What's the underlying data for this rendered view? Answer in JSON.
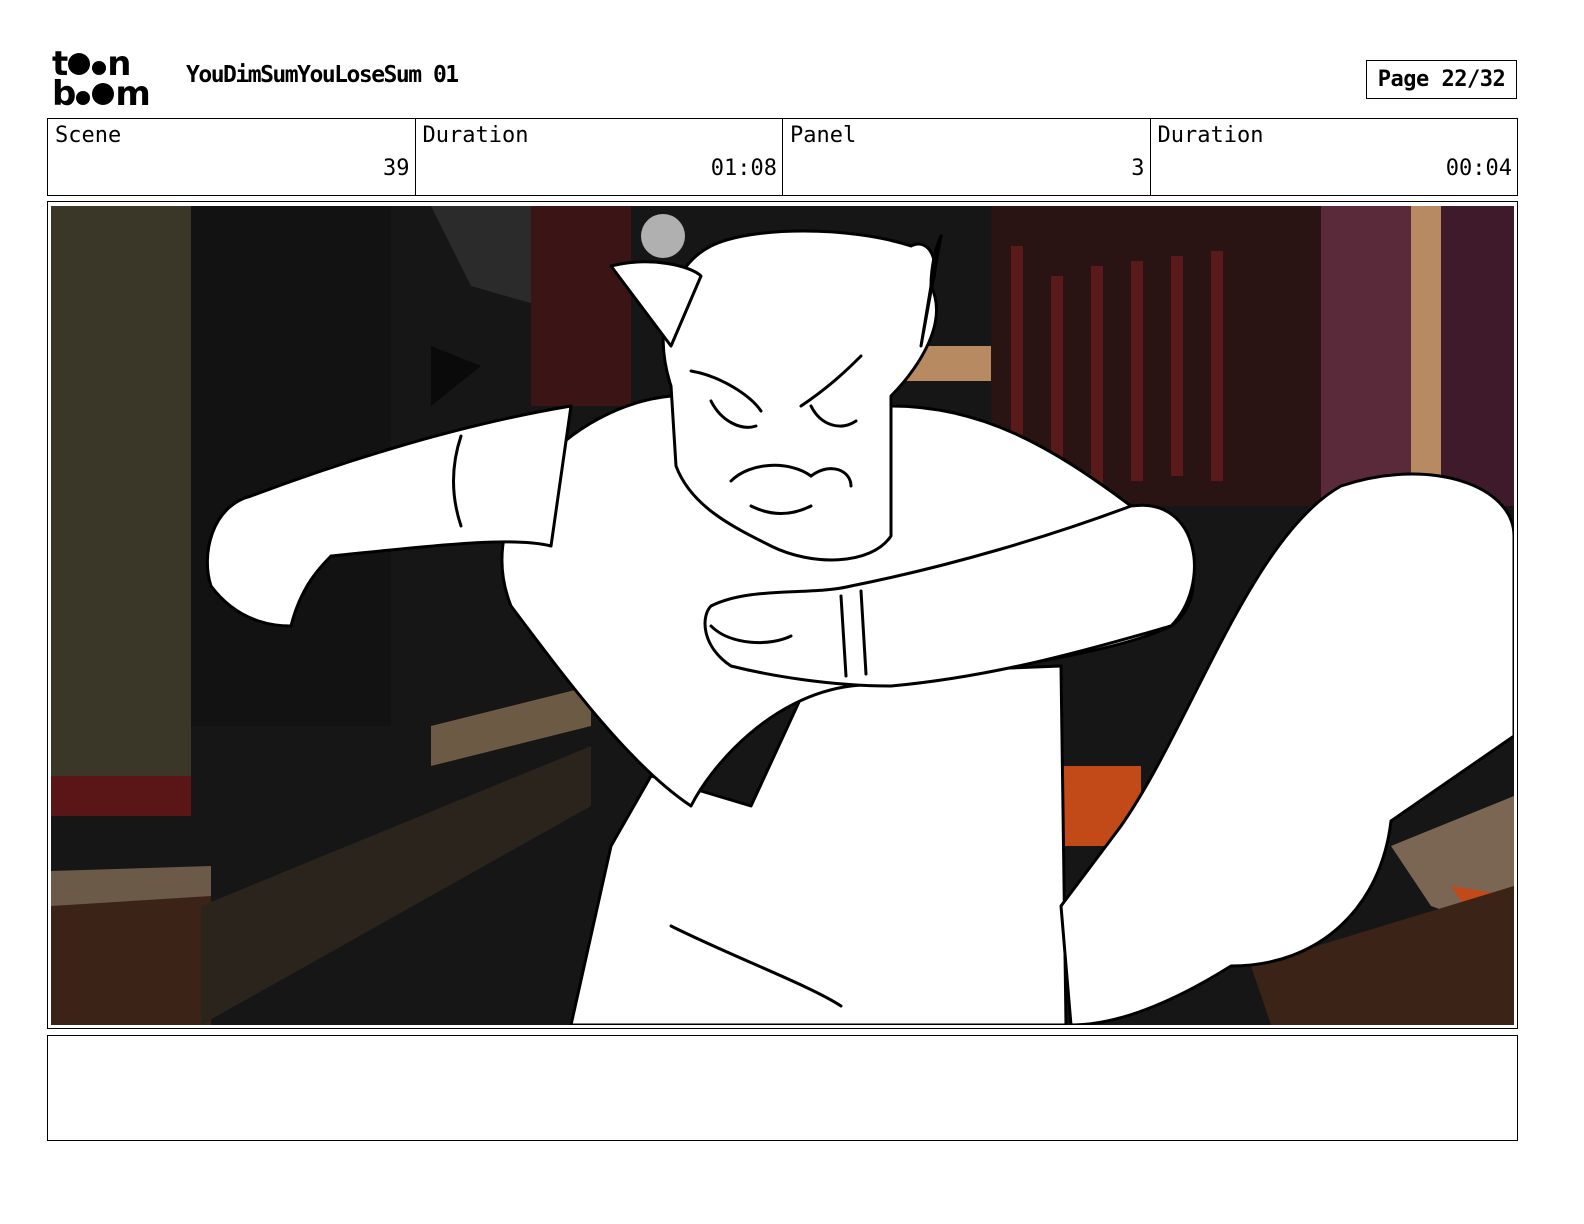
{
  "header": {
    "logo_top": "t",
    "logo_top_end": "n",
    "logo_bottom": "b",
    "logo_bottom_end": "m",
    "title": "YouDimSumYouLoseSum 01",
    "page": "Page 22/32"
  },
  "info": {
    "scene_label": "Scene",
    "scene_value": "39",
    "scene_duration_label": "Duration",
    "scene_duration_value": "01:08",
    "panel_label": "Panel",
    "panel_value": "3",
    "panel_duration_label": "Duration",
    "panel_duration_value": "00:04"
  },
  "notes": {
    "text": ""
  }
}
